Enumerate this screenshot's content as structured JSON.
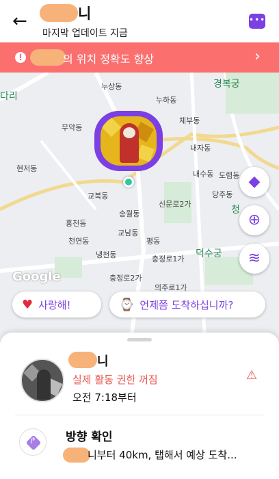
{
  "header": {
    "back_icon": "arrow-left-icon",
    "title": "니",
    "subtitle": "마지막 업데이트 지금",
    "chat_icon": "chat-bubble-icon"
  },
  "banner": {
    "text": "의 위치 정확도 향상",
    "icon": "alert-circle-icon",
    "chevron": "chevron-right-icon",
    "color": "#fb6f6f"
  },
  "map": {
    "places": [
      "누상동",
      "누하동",
      "경복궁",
      "무악동",
      "체부동",
      "내자동",
      "현저동",
      "내수동",
      "도렴동",
      "교북동",
      "당주동",
      "신문로2가",
      "송월동",
      "홍천동",
      "교남동",
      "평동",
      "천연동",
      "냉천동",
      "충정로1가",
      "덕수궁",
      "충정로2가",
      "의주로1가",
      "다리",
      "청"
    ],
    "watermark": "Google"
  },
  "chips": {
    "love": "사랑해!",
    "arrival": "언제쯤 도착하십니까?"
  },
  "card": {
    "name": "니",
    "status": "실제 활동 권한 꺼짐",
    "since": "오전 7:18부터",
    "direction_title": "방향 확인",
    "direction_text": "니부터 40km, 탭해서 예상 도착..."
  },
  "colors": {
    "accent": "#7b3fe4",
    "alert": "#e8574f"
  }
}
